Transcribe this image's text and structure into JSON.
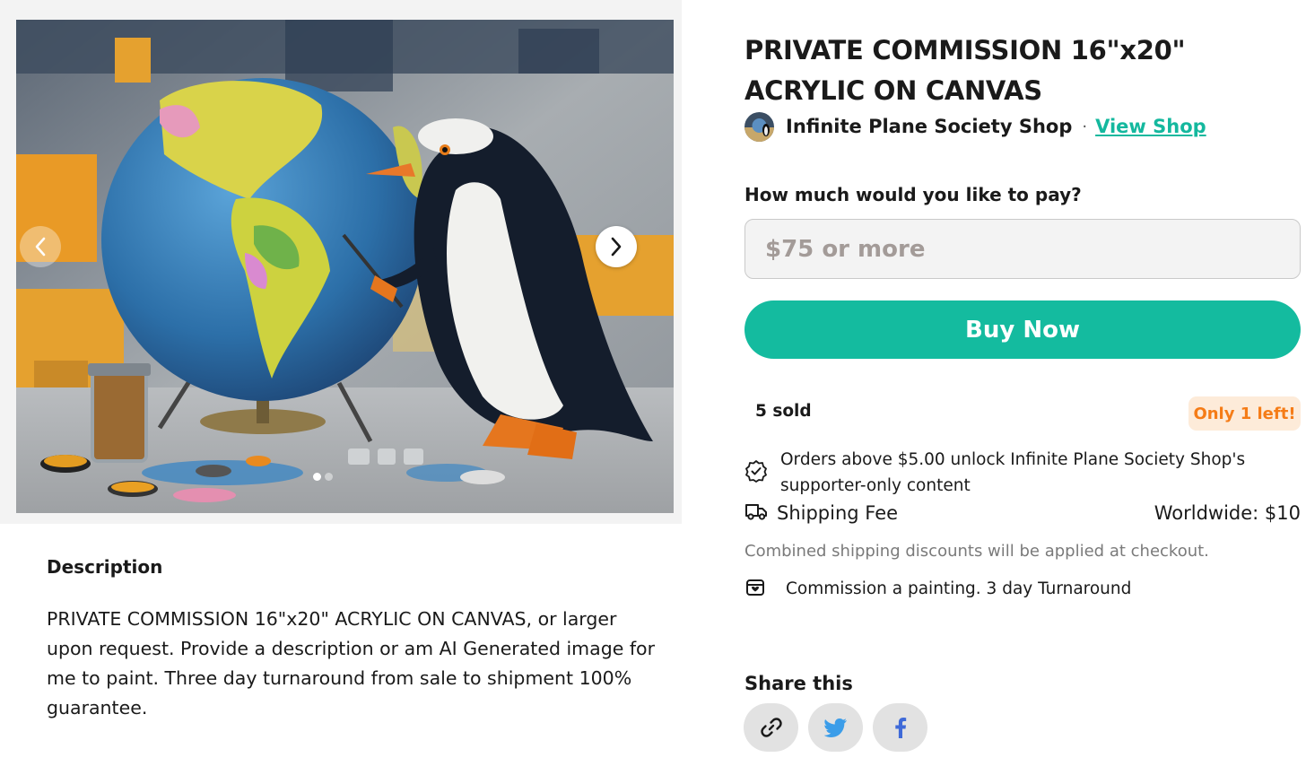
{
  "product": {
    "title": "PRIVATE COMMISSION 16\"x20\" ACRYLIC ON CANVAS",
    "shop_name": "Infinite Plane Society Shop",
    "separator": "·",
    "view_shop_label": "View Shop"
  },
  "gallery": {
    "slide_count": 2,
    "active_slide": 1,
    "prev_icon": "chevron-left-icon",
    "next_icon": "chevron-right-icon"
  },
  "purchase": {
    "pay_label": "How much would you like to pay?",
    "pay_placeholder": "$75 or more",
    "pay_value": "",
    "buy_label": "Buy Now",
    "sold_text": "5 sold",
    "stock_badge": "Only 1 left!"
  },
  "perks": {
    "supporter_text": "Orders above $5.00 unlock Infinite Plane Society Shop's supporter-only content",
    "shipping_label": "Shipping Fee",
    "shipping_value": "Worldwide: $10",
    "shipping_note": "Combined shipping discounts will be applied at checkout.",
    "commission_text": "Commission a painting. 3 day Turnaround"
  },
  "description": {
    "title": "Description",
    "body": "PRIVATE COMMISSION 16\"x20\" ACRYLIC ON CANVAS, or larger upon request. Provide a description or am AI Generated image for me to paint. Three day turnaround from sale to shipment 100% guarantee."
  },
  "share": {
    "title": "Share this",
    "buttons": [
      "link-icon",
      "twitter-icon",
      "facebook-icon"
    ]
  },
  "colors": {
    "accent": "#14bb9f",
    "link": "#14b89e",
    "badge_text": "#f57c17",
    "badge_bg": "#fdebd9",
    "twitter": "#3b9de9",
    "facebook": "#3f6ad8"
  }
}
